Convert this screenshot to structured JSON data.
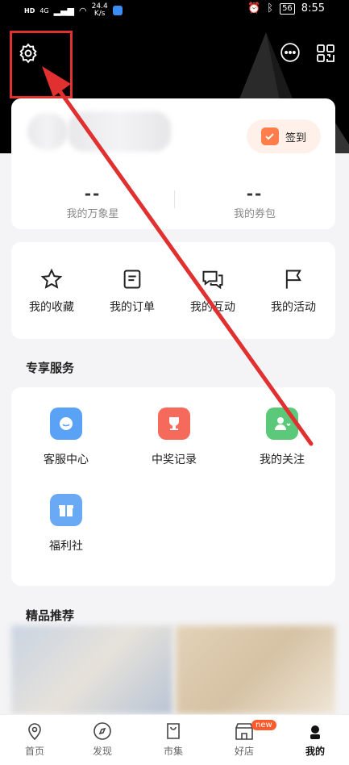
{
  "status": {
    "hd1": "HD",
    "sig1": "4G",
    "speed": "24.4",
    "speed_unit": "K/s",
    "battery": "56",
    "time": "8:55"
  },
  "checkin": {
    "label": "签到"
  },
  "stats": [
    {
      "value": "--",
      "label": "我的万象星"
    },
    {
      "value": "--",
      "label": "我的券包"
    }
  ],
  "quick": [
    {
      "label": "我的收藏",
      "icon": "star-icon"
    },
    {
      "label": "我的订单",
      "icon": "order-icon"
    },
    {
      "label": "我的互动",
      "icon": "chat-icon"
    },
    {
      "label": "我的活动",
      "icon": "flag-icon"
    }
  ],
  "services_title": "专享服务",
  "services": [
    {
      "label": "客服中心",
      "icon": "customer-service-icon",
      "color": "#5aa2f5"
    },
    {
      "label": "中奖记录",
      "icon": "trophy-icon",
      "color": "#f56a5a"
    },
    {
      "label": "我的关注",
      "icon": "follow-icon",
      "color": "#5cc97a"
    },
    {
      "label": "福利社",
      "icon": "gift-icon",
      "color": "#6aaaf5"
    }
  ],
  "recommend_title": "精品推荐",
  "tabs": [
    {
      "label": "首页"
    },
    {
      "label": "发现"
    },
    {
      "label": "市集"
    },
    {
      "label": "好店",
      "badge": "new"
    },
    {
      "label": "我的"
    }
  ],
  "colors": {
    "accent": "#ff5a2b",
    "annotation": "#e03030"
  }
}
